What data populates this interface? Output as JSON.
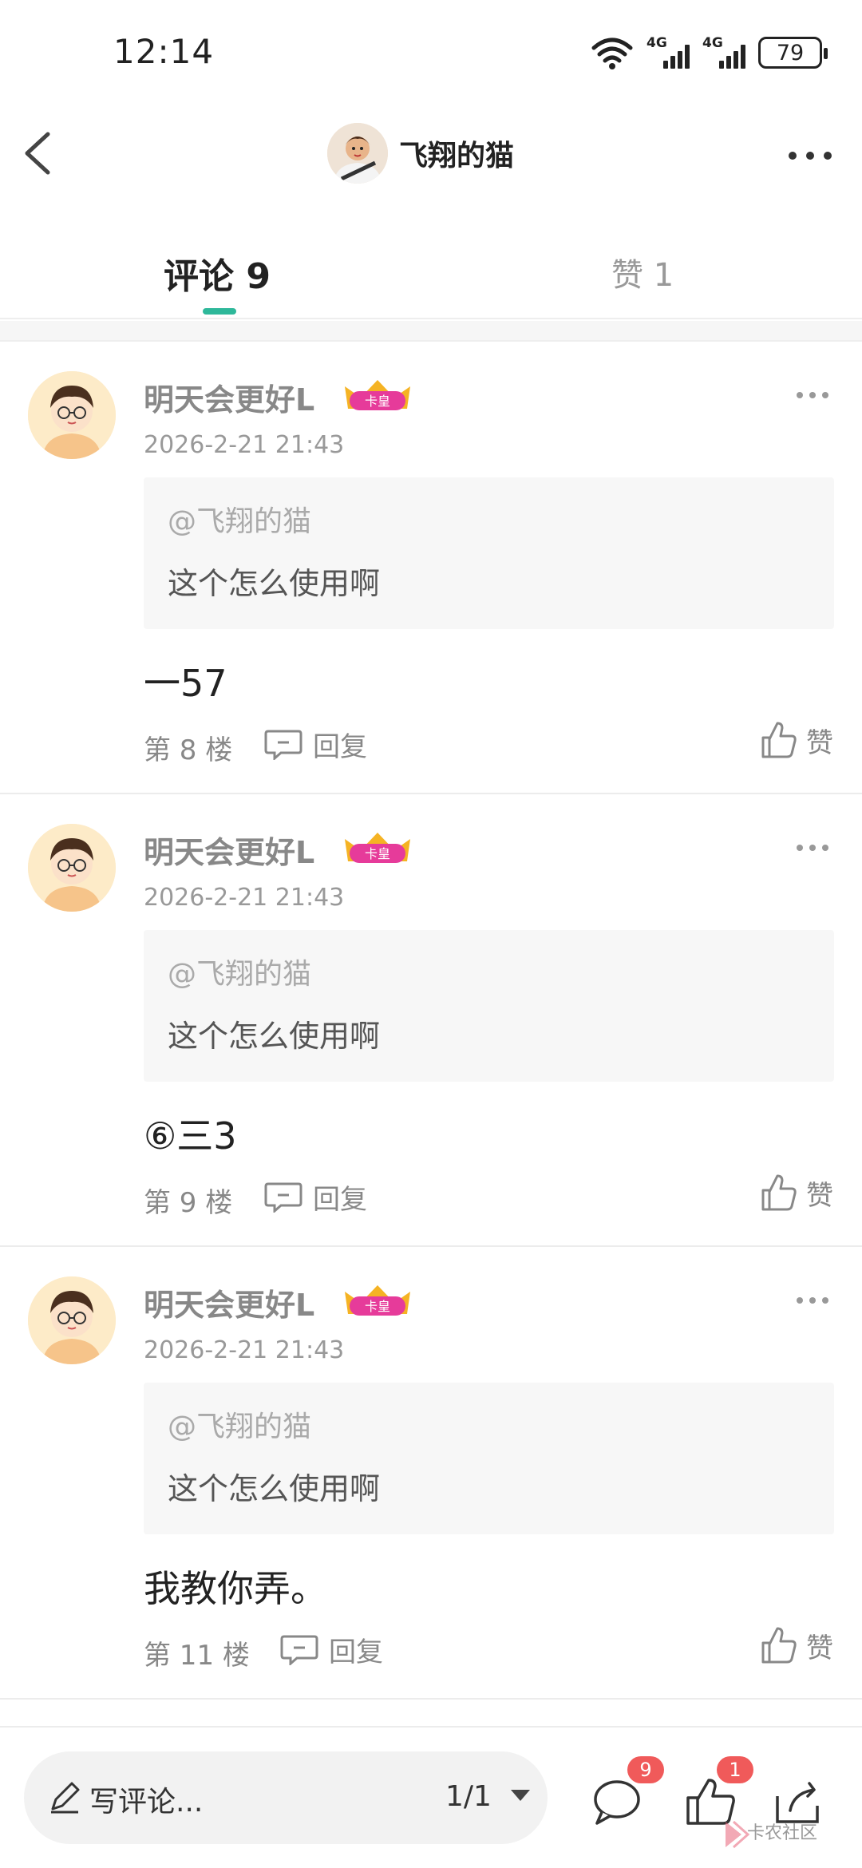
{
  "status_bar": {
    "time": "12:14",
    "network_1": "4G",
    "network_2": "4G",
    "battery": "79"
  },
  "header": {
    "title": "飞翔的猫"
  },
  "tabs": {
    "comments": "评论 9",
    "likes": "赞 1"
  },
  "comments": [
    {
      "author": "明天会更好L",
      "badge": "卡皇",
      "time": "2026-2-21 21:43",
      "quote_at": "@飞翔的猫",
      "quote_text": "这个怎么使用啊",
      "body": "一57",
      "floor": "第 8 楼",
      "reply_label": "回复",
      "like_label": "赞"
    },
    {
      "author": "明天会更好L",
      "badge": "卡皇",
      "time": "2026-2-21 21:43",
      "quote_at": "@飞翔的猫",
      "quote_text": "这个怎么使用啊",
      "body": "⑥三3",
      "floor": "第 9 楼",
      "reply_label": "回复",
      "like_label": "赞"
    },
    {
      "author": "明天会更好L",
      "badge": "卡皇",
      "time": "2026-2-21 21:43",
      "quote_at": "@飞翔的猫",
      "quote_text": "这个怎么使用啊",
      "body": "我教你弄。",
      "floor": "第 11 楼",
      "reply_label": "回复",
      "like_label": "赞"
    }
  ],
  "bottom_bar": {
    "write_label": "写评论...",
    "page_indicator": "1/1",
    "comment_count": "9",
    "like_count": "1",
    "watermark": "卡农社区"
  },
  "colors": {
    "accent": "#2eb89a",
    "badge_red": "#f05a5a",
    "badge_pink": "#e63b9a",
    "crown_gold": "#f5b324"
  }
}
